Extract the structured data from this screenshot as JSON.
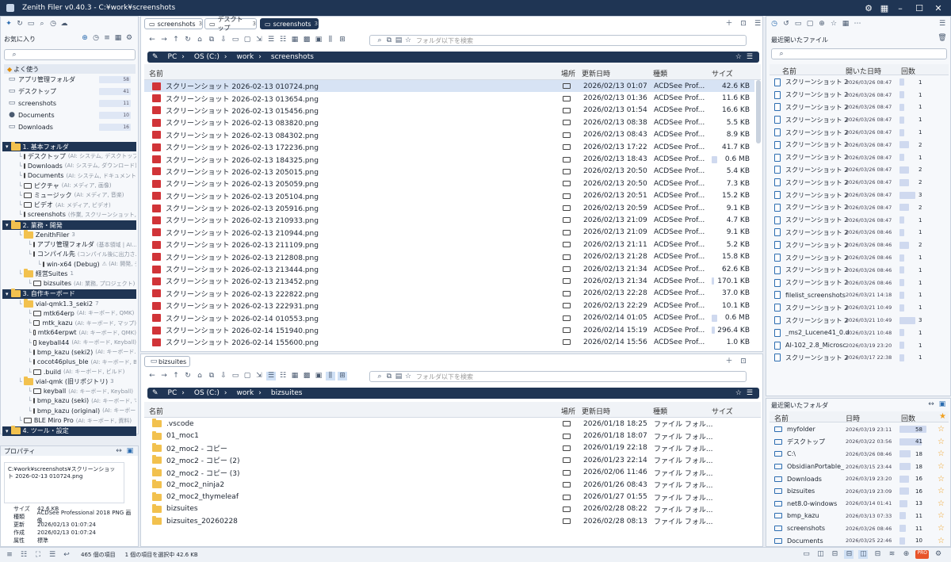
{
  "window": {
    "title": "Zenith Filer v0.40.3 - C:¥work¥screenshots"
  },
  "sidebar": {
    "favorites_label": "お気に入り",
    "section_label": "よく使う",
    "quick": [
      {
        "label": "アプリ管理フォルダ",
        "count": "58"
      },
      {
        "label": "デスクトップ",
        "count": "41"
      },
      {
        "label": "screenshots",
        "count": "11"
      },
      {
        "label": "Documents",
        "count": "10"
      },
      {
        "label": "Downloads",
        "count": "16"
      }
    ],
    "tree": [
      {
        "type": "sec",
        "label": "1. 基本フォルダ"
      },
      {
        "type": "item",
        "indent": 1,
        "label": "デスクトップ",
        "note": "(AI: システム, デスクトップ)"
      },
      {
        "type": "item",
        "indent": 1,
        "label": "Downloads",
        "note": "(AI: システム, ダウンロード)"
      },
      {
        "type": "item",
        "indent": 1,
        "label": "Documents",
        "note": "(AI: システム, ドキュメント)"
      },
      {
        "type": "item",
        "indent": 1,
        "label": "ピクチャ",
        "note": "(AI: メディア, 画像)"
      },
      {
        "type": "item",
        "indent": 1,
        "label": "ミュージック",
        "note": "(AI: メディア, 音楽)"
      },
      {
        "type": "item",
        "indent": 1,
        "label": "ビデオ",
        "note": "(AI: メディア, ビデオ)"
      },
      {
        "type": "item",
        "indent": 1,
        "label": "screenshots",
        "note": "(作業, スクリーンショット, ..."
      },
      {
        "type": "sec",
        "label": "2. 業務・開発"
      },
      {
        "type": "item",
        "indent": 1,
        "label": "ZenithFiler",
        "note": "3"
      },
      {
        "type": "item",
        "indent": 2,
        "label": "アプリ管理フォルダ",
        "note": "(基本領域 | AI..."
      },
      {
        "type": "item",
        "indent": 2,
        "label": "コンパイル先",
        "note": "(コンパイル後に出力さ..."
      },
      {
        "type": "item",
        "indent": 3,
        "label": "win-x64 (Debug)",
        "note": "⚠ (AI: 開発, デ..."
      },
      {
        "type": "item",
        "indent": 1,
        "label": "経営Suites",
        "note": "1"
      },
      {
        "type": "item",
        "indent": 2,
        "label": "bizsuites",
        "note": "(AI: 業務, プロジェクト)"
      },
      {
        "type": "sec",
        "label": "3. 自作キーボード"
      },
      {
        "type": "item",
        "indent": 1,
        "label": "vial-qmk1.3_seki2",
        "note": "7"
      },
      {
        "type": "item",
        "indent": 2,
        "label": "mtk64erp",
        "note": "(AI: キーボード, QMK)"
      },
      {
        "type": "item",
        "indent": 2,
        "label": "mtk_kazu",
        "note": "(AI: キーボード, マップ)"
      },
      {
        "type": "item",
        "indent": 2,
        "label": "mtk64erpwt",
        "note": "(AI: キーボード, QMK)"
      },
      {
        "type": "item",
        "indent": 2,
        "label": "keyball44",
        "note": "(AI: キーボード, Keyball)"
      },
      {
        "type": "item",
        "indent": 2,
        "label": "bmp_kazu (seki2)",
        "note": "(AI: キーボード..."
      },
      {
        "type": "item",
        "indent": 2,
        "label": "cocot46plus_ble",
        "note": "(AI: キーボード, B..."
      },
      {
        "type": "item",
        "indent": 2,
        "label": ".build",
        "note": "(AI: キーボード, ビルド)"
      },
      {
        "type": "item",
        "indent": 1,
        "label": "vial-qmk (旧リポジトリ)",
        "note": "3"
      },
      {
        "type": "item",
        "indent": 2,
        "label": "keyball",
        "note": "(AI: キーボード, Keyball)"
      },
      {
        "type": "item",
        "indent": 2,
        "label": "bmp_kazu (seki)",
        "note": "(AI: キーボード, マ..."
      },
      {
        "type": "item",
        "indent": 2,
        "label": "bmp_kazu (original)",
        "note": "(AI: キーボー..."
      },
      {
        "type": "item",
        "indent": 1,
        "label": "BLE Miro Pro",
        "note": "(AI: キーボード, 資料)"
      },
      {
        "type": "sec",
        "label": "4. ツール・設定"
      }
    ]
  },
  "properties": {
    "title": "プロパティ",
    "path": "C:¥work¥screenshots¥スクリーンショット 2026-02-13 010724.png",
    "rows": [
      {
        "k": "サイズ",
        "v": "42.6 KB"
      },
      {
        "k": "種類",
        "v": "ACDSee Professional 2018 PNG 画像"
      },
      {
        "k": "更新",
        "v": "2026/02/13 01:07:24"
      },
      {
        "k": "作成",
        "v": "2026/02/13 01:07:24"
      },
      {
        "k": "属性",
        "v": "標準"
      }
    ]
  },
  "pane1": {
    "tabs": [
      {
        "label": "screenshots",
        "count": "3"
      },
      {
        "label": "デスクトップ",
        "count": "3"
      },
      {
        "label": "screenshots",
        "count": "3"
      }
    ],
    "search_placeholder": "フォルダ以下を検索",
    "path": [
      "PC",
      "OS (C:)",
      "work",
      "screenshots"
    ],
    "columns": {
      "name": "名前",
      "loc": "場所",
      "date": "更新日時",
      "type": "種類",
      "size": "サイズ"
    },
    "rows": [
      {
        "name": "スクリーンショット 2026-02-13 010724.png",
        "date": "2026/02/13 01:07",
        "type": "ACDSee Prof...",
        "size": "42.6 KB",
        "bar": 0
      },
      {
        "name": "スクリーンショット 2026-02-13 013654.png",
        "date": "2026/02/13 01:36",
        "type": "ACDSee Prof...",
        "size": "11.6 KB",
        "bar": 0
      },
      {
        "name": "スクリーンショット 2026-02-13 015456.png",
        "date": "2026/02/13 01:54",
        "type": "ACDSee Prof...",
        "size": "16.6 KB",
        "bar": 0
      },
      {
        "name": "スクリーンショット 2026-02-13 083820.png",
        "date": "2026/02/13 08:38",
        "type": "ACDSee Prof...",
        "size": "5.5 KB",
        "bar": 0
      },
      {
        "name": "スクリーンショット 2026-02-13 084302.png",
        "date": "2026/02/13 08:43",
        "type": "ACDSee Prof...",
        "size": "8.9 KB",
        "bar": 0
      },
      {
        "name": "スクリーンショット 2026-02-13 172236.png",
        "date": "2026/02/13 17:22",
        "type": "ACDSee Prof...",
        "size": "41.7 KB",
        "bar": 0
      },
      {
        "name": "スクリーンショット 2026-02-13 184325.png",
        "date": "2026/02/13 18:43",
        "type": "ACDSee Prof...",
        "size": "0.6 MB",
        "bar": 0.12
      },
      {
        "name": "スクリーンショット 2026-02-13 205015.png",
        "date": "2026/02/13 20:50",
        "type": "ACDSee Prof...",
        "size": "5.4 KB",
        "bar": 0
      },
      {
        "name": "スクリーンショット 2026-02-13 205059.png",
        "date": "2026/02/13 20:50",
        "type": "ACDSee Prof...",
        "size": "7.3 KB",
        "bar": 0
      },
      {
        "name": "スクリーンショット 2026-02-13 205104.png",
        "date": "2026/02/13 20:51",
        "type": "ACDSee Prof...",
        "size": "15.2 KB",
        "bar": 0
      },
      {
        "name": "スクリーンショット 2026-02-13 205916.png",
        "date": "2026/02/13 20:59",
        "type": "ACDSee Prof...",
        "size": "9.1 KB",
        "bar": 0
      },
      {
        "name": "スクリーンショット 2026-02-13 210933.png",
        "date": "2026/02/13 21:09",
        "type": "ACDSee Prof...",
        "size": "4.7 KB",
        "bar": 0
      },
      {
        "name": "スクリーンショット 2026-02-13 210944.png",
        "date": "2026/02/13 21:09",
        "type": "ACDSee Prof...",
        "size": "9.1 KB",
        "bar": 0
      },
      {
        "name": "スクリーンショット 2026-02-13 211109.png",
        "date": "2026/02/13 21:11",
        "type": "ACDSee Prof...",
        "size": "5.2 KB",
        "bar": 0
      },
      {
        "name": "スクリーンショット 2026-02-13 212808.png",
        "date": "2026/02/13 21:28",
        "type": "ACDSee Prof...",
        "size": "15.8 KB",
        "bar": 0
      },
      {
        "name": "スクリーンショット 2026-02-13 213444.png",
        "date": "2026/02/13 21:34",
        "type": "ACDSee Prof...",
        "size": "62.6 KB",
        "bar": 0
      },
      {
        "name": "スクリーンショット 2026-02-13 213452.png",
        "date": "2026/02/13 21:34",
        "type": "ACDSee Prof...",
        "size": "170.1 KB",
        "bar": 0.05
      },
      {
        "name": "スクリーンショット 2026-02-13 222822.png",
        "date": "2026/02/13 22:28",
        "type": "ACDSee Prof...",
        "size": "37.0 KB",
        "bar": 0
      },
      {
        "name": "スクリーンショット 2026-02-13 222931.png",
        "date": "2026/02/13 22:29",
        "type": "ACDSee Prof...",
        "size": "10.1 KB",
        "bar": 0
      },
      {
        "name": "スクリーンショット 2026-02-14 010553.png",
        "date": "2026/02/14 01:05",
        "type": "ACDSee Prof...",
        "size": "0.6 MB",
        "bar": 0.12
      },
      {
        "name": "スクリーンショット 2026-02-14 151940.png",
        "date": "2026/02/14 15:19",
        "type": "ACDSee Prof...",
        "size": "296.4 KB",
        "bar": 0.07
      },
      {
        "name": "スクリーンショット 2026-02-14 155600.png",
        "date": "2026/02/14 15:56",
        "type": "ACDSee Prof...",
        "size": "1.0 KB",
        "bar": 0
      }
    ]
  },
  "pane2": {
    "tab": "bizsuites",
    "search_placeholder": "フォルダ以下を検索",
    "path": [
      "PC",
      "OS (C:)",
      "work",
      "bizsuites"
    ],
    "columns": {
      "name": "名前",
      "loc": "場所",
      "date": "更新日時",
      "type": "種類",
      "size": "サイズ"
    },
    "rows": [
      {
        "name": ".vscode",
        "date": "2026/01/18 18:25",
        "type": "ファイル フォル..."
      },
      {
        "name": "01_moc1",
        "date": "2026/01/18 18:07",
        "type": "ファイル フォル..."
      },
      {
        "name": "02_moc2 - コピー",
        "date": "2026/01/19 22:18",
        "type": "ファイル フォル..."
      },
      {
        "name": "02_moc2 - コピー (2)",
        "date": "2026/01/23 22:14",
        "type": "ファイル フォル..."
      },
      {
        "name": "02_moc2 - コピー (3)",
        "date": "2026/02/06 11:46",
        "type": "ファイル フォル..."
      },
      {
        "name": "02_moc2_ninja2",
        "date": "2026/01/26 08:43",
        "type": "ファイル フォル..."
      },
      {
        "name": "02_moc2_thymeleaf",
        "date": "2026/01/27 01:55",
        "type": "ファイル フォル..."
      },
      {
        "name": "bizsuites",
        "date": "2026/02/28 08:22",
        "type": "ファイル フォル..."
      },
      {
        "name": "bizsuites_20260228",
        "date": "2026/02/28 08:13",
        "type": "ファイル フォル..."
      }
    ]
  },
  "recent_files": {
    "title": "最近開いたファイル",
    "columns": {
      "name": "名前",
      "date": "開いた日時",
      "count": "回数"
    },
    "rows": [
      {
        "name": "スクリーンショット 202",
        "date": "2026/03/26 08:47",
        "count": "1",
        "bar": 0.1
      },
      {
        "name": "スクリーンショット 202",
        "date": "2026/03/26 08:47",
        "count": "1",
        "bar": 0.1
      },
      {
        "name": "スクリーンショット 202",
        "date": "2026/03/26 08:47",
        "count": "1",
        "bar": 0.1
      },
      {
        "name": "スクリーンショット 202",
        "date": "2026/03/26 08:47",
        "count": "1",
        "bar": 0.1
      },
      {
        "name": "スクリーンショット 202",
        "date": "2026/03/26 08:47",
        "count": "1",
        "bar": 0.1
      },
      {
        "name": "スクリーンショット 202",
        "date": "2026/03/26 08:47",
        "count": "2",
        "bar": 0.3
      },
      {
        "name": "スクリーンショット 202",
        "date": "2026/03/26 08:47",
        "count": "1",
        "bar": 0.1
      },
      {
        "name": "スクリーンショット 202",
        "date": "2026/03/26 08:47",
        "count": "2",
        "bar": 0.3
      },
      {
        "name": "スクリーンショット 202",
        "date": "2026/03/26 08:47",
        "count": "2",
        "bar": 0.3
      },
      {
        "name": "スクリーンショット 202",
        "date": "2026/03/26 08:47",
        "count": "3",
        "bar": 0.5
      },
      {
        "name": "スクリーンショット 202",
        "date": "2026/03/26 08:47",
        "count": "2",
        "bar": 0.3
      },
      {
        "name": "スクリーンショット 202",
        "date": "2026/03/26 08:47",
        "count": "1",
        "bar": 0.1
      },
      {
        "name": "スクリーンショット 202",
        "date": "2026/03/26 08:46",
        "count": "1",
        "bar": 0.1
      },
      {
        "name": "スクリーンショット 202",
        "date": "2026/03/26 08:46",
        "count": "2",
        "bar": 0.3
      },
      {
        "name": "スクリーンショット 202",
        "date": "2026/03/26 08:46",
        "count": "1",
        "bar": 0.1
      },
      {
        "name": "スクリーンショット 202",
        "date": "2026/03/26 08:46",
        "count": "1",
        "bar": 0.1
      },
      {
        "name": "スクリーンショット 202",
        "date": "2026/03/26 08:46",
        "count": "1",
        "bar": 0.1
      },
      {
        "name": "filelist_screenshots",
        "date": "2026/03/21 14:18",
        "count": "1",
        "bar": 0.1
      },
      {
        "name": "スクリーンショット 202",
        "date": "2026/03/21 10:49",
        "count": "1",
        "bar": 0.1
      },
      {
        "name": "スクリーンショット 202",
        "date": "2026/03/21 10:49",
        "count": "3",
        "bar": 0.5
      },
      {
        "name": "_ms2_Lucene41_0.d",
        "date": "2026/03/21 10:48",
        "count": "1",
        "bar": 0.1
      },
      {
        "name": "AI-102_2.8_Microsc",
        "date": "2026/03/19 23:20",
        "count": "1",
        "bar": 0.1
      },
      {
        "name": "スクリーンショット 202",
        "date": "2026/03/17 22:38",
        "count": "1",
        "bar": 0.1
      }
    ]
  },
  "recent_folders": {
    "title": "最近開いたフォルダ",
    "columns": {
      "name": "名前",
      "date": "日時",
      "count": "回数"
    },
    "rows": [
      {
        "name": "myfolder",
        "date": "2026/03/19 23:11",
        "count": "58",
        "bar": 0.85
      },
      {
        "name": "デスクトップ",
        "date": "2026/03/22 03:56",
        "count": "41",
        "bar": 0.7
      },
      {
        "name": "C:\\",
        "date": "2026/03/26 08:46",
        "count": "18",
        "bar": 0.35
      },
      {
        "name": "ObsidianPortable_",
        "date": "2026/03/15 23:44",
        "count": "18",
        "bar": 0.35
      },
      {
        "name": "Downloads",
        "date": "2026/03/19 23:20",
        "count": "16",
        "bar": 0.3
      },
      {
        "name": "bizsuites",
        "date": "2026/03/19 23:09",
        "count": "16",
        "bar": 0.3
      },
      {
        "name": "net8.0-windows",
        "date": "2026/03/14 01:41",
        "count": "13",
        "bar": 0.25
      },
      {
        "name": "bmp_kazu",
        "date": "2026/03/13 07:33",
        "count": "11",
        "bar": 0.2
      },
      {
        "name": "screenshots",
        "date": "2026/03/26 08:46",
        "count": "11",
        "bar": 0.2
      },
      {
        "name": "Documents",
        "date": "2026/03/25 22:46",
        "count": "10",
        "bar": 0.18
      }
    ]
  },
  "statusbar": {
    "items": "465 個の項目",
    "selected": "1 個の項目を選択中 42.6 KB"
  },
  "colors": {
    "accent": "#1f3554",
    "selected": "#d7e3f4",
    "folder": "#f2c14e",
    "png": "#d13438"
  }
}
